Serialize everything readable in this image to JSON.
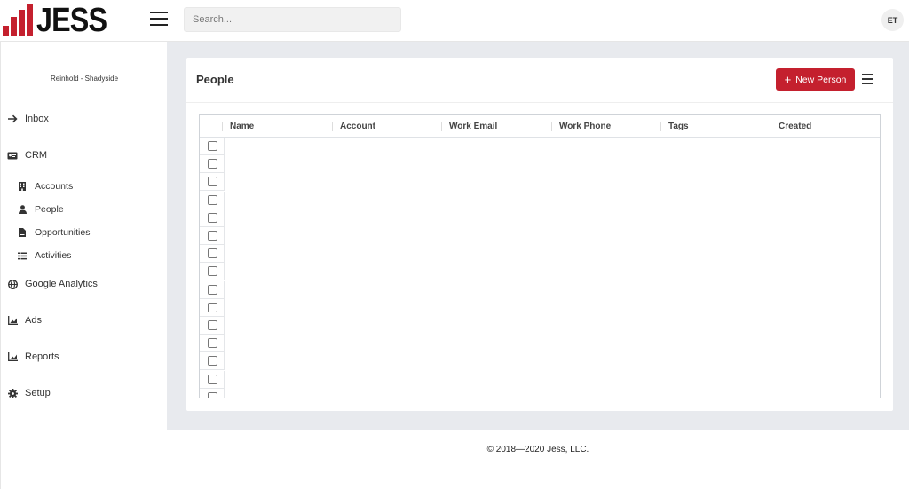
{
  "brand": {
    "logo_text": "JESS",
    "logo_color": "#c4202e"
  },
  "header": {
    "search_placeholder": "Search...",
    "avatar_initials": "ET"
  },
  "sidebar": {
    "org_name": "Reinhold - Shadyside",
    "items": [
      {
        "label": "Inbox",
        "icon": "arrow-right-icon"
      },
      {
        "label": "CRM",
        "icon": "id-card-icon"
      },
      {
        "label": "Accounts",
        "icon": "building-icon"
      },
      {
        "label": "People",
        "icon": "person-icon"
      },
      {
        "label": "Opportunities",
        "icon": "file-icon"
      },
      {
        "label": "Activities",
        "icon": "list-check-icon"
      },
      {
        "label": "Google Analytics",
        "icon": "globe-icon"
      },
      {
        "label": "Ads",
        "icon": "chart-area-icon"
      },
      {
        "label": "Reports",
        "icon": "chart-area-icon"
      },
      {
        "label": "Setup",
        "icon": "gear-icon"
      }
    ]
  },
  "page": {
    "title": "People",
    "new_button_label": "New Person",
    "accent_color": "#c4202e"
  },
  "table": {
    "columns": [
      "Name",
      "Account",
      "Work Email",
      "Work Phone",
      "Tags",
      "Created"
    ]
  },
  "footer": {
    "copyright": "© 2018—2020 Jess, LLC."
  }
}
